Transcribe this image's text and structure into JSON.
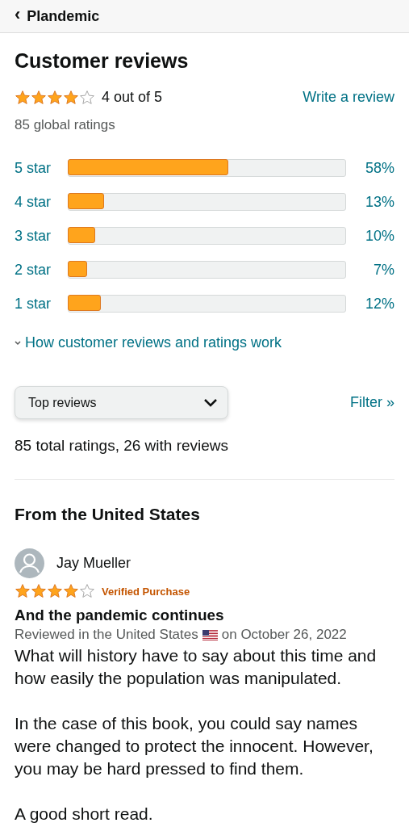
{
  "header": {
    "back": "‹",
    "title": "Plandemic"
  },
  "summary": {
    "title": "Customer reviews",
    "stars": 4,
    "rating": "4 out of 5",
    "write_link": "Write a review",
    "global": "85 global ratings"
  },
  "histogram": [
    {
      "label": "5 star",
      "level": 0.58,
      "percent": "58%"
    },
    {
      "label": "4 star",
      "level": 0.13,
      "percent": "13%"
    },
    {
      "label": "3 star",
      "level": 0.1,
      "percent": "10%"
    },
    {
      "label": "2 star",
      "level": 0.07,
      "percent": "7%"
    },
    {
      "label": "1 star",
      "level": 0.12,
      "percent": "12%"
    }
  ],
  "how_link": "How customer reviews and ratings work",
  "sort": {
    "value": "Top reviews"
  },
  "filter_link": "Filter »",
  "totals": "85 total ratings, 26 with reviews",
  "section_title": "From the United States",
  "reviews": [
    {
      "author": "Jay Mueller",
      "stars": 4,
      "badge": "Verified Purchase",
      "title": "And the pandemic continues",
      "reviewed_in": "Reviewed in the United States",
      "date": "on October 26, 2022",
      "paragraphs": [
        "What will history have to say about this time and how easily the population was manipulated.",
        "In the case of this book, you could say names were changed to protect the innocent. However, you may be hard pressed to find them.",
        "A good short read."
      ]
    }
  ]
}
